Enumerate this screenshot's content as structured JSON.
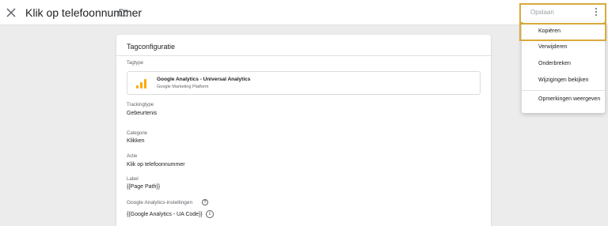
{
  "topbar": {
    "title": "Klik op telefoonnummer",
    "save_label": "Opslaan",
    "close_icon": "close-icon",
    "folder_icon": "folder-icon",
    "more_icon": "more-vert-icon"
  },
  "card": {
    "title": "Tagconfiguratie",
    "tagtype_label": "Tagtype",
    "tagtype_name": "Google Analytics - Universal Analytics",
    "tagtype_sub": "Google Marketing Platform",
    "tagtype_icon": "google-analytics-icon",
    "trackingtype_label": "Trackingtype",
    "trackingtype_value": "Gebeurtenis",
    "category_label": "Categorie",
    "category_value": "Klikken",
    "action_label": "Actie",
    "action_value": "Klik op telefoonnummer",
    "label_label": "Label",
    "label_value": "{{Page Path}}",
    "ga_settings_label": "Google Analytics-instellingen",
    "ga_settings_value": "{{Google Analytics - UA Code}}",
    "help_glyph": "?",
    "info_glyph": "i"
  },
  "menu": {
    "items": [
      {
        "label": "Kopiëren"
      },
      {
        "label": "Verwijderen"
      },
      {
        "label": "Onderbreken"
      },
      {
        "label": "Wijzigingen bekijken"
      },
      {
        "label": "Opmerkingen weergeven"
      }
    ]
  },
  "colors": {
    "highlight": "#d9a93c",
    "ga_orange": "#f9ab00",
    "background": "#ececec"
  }
}
